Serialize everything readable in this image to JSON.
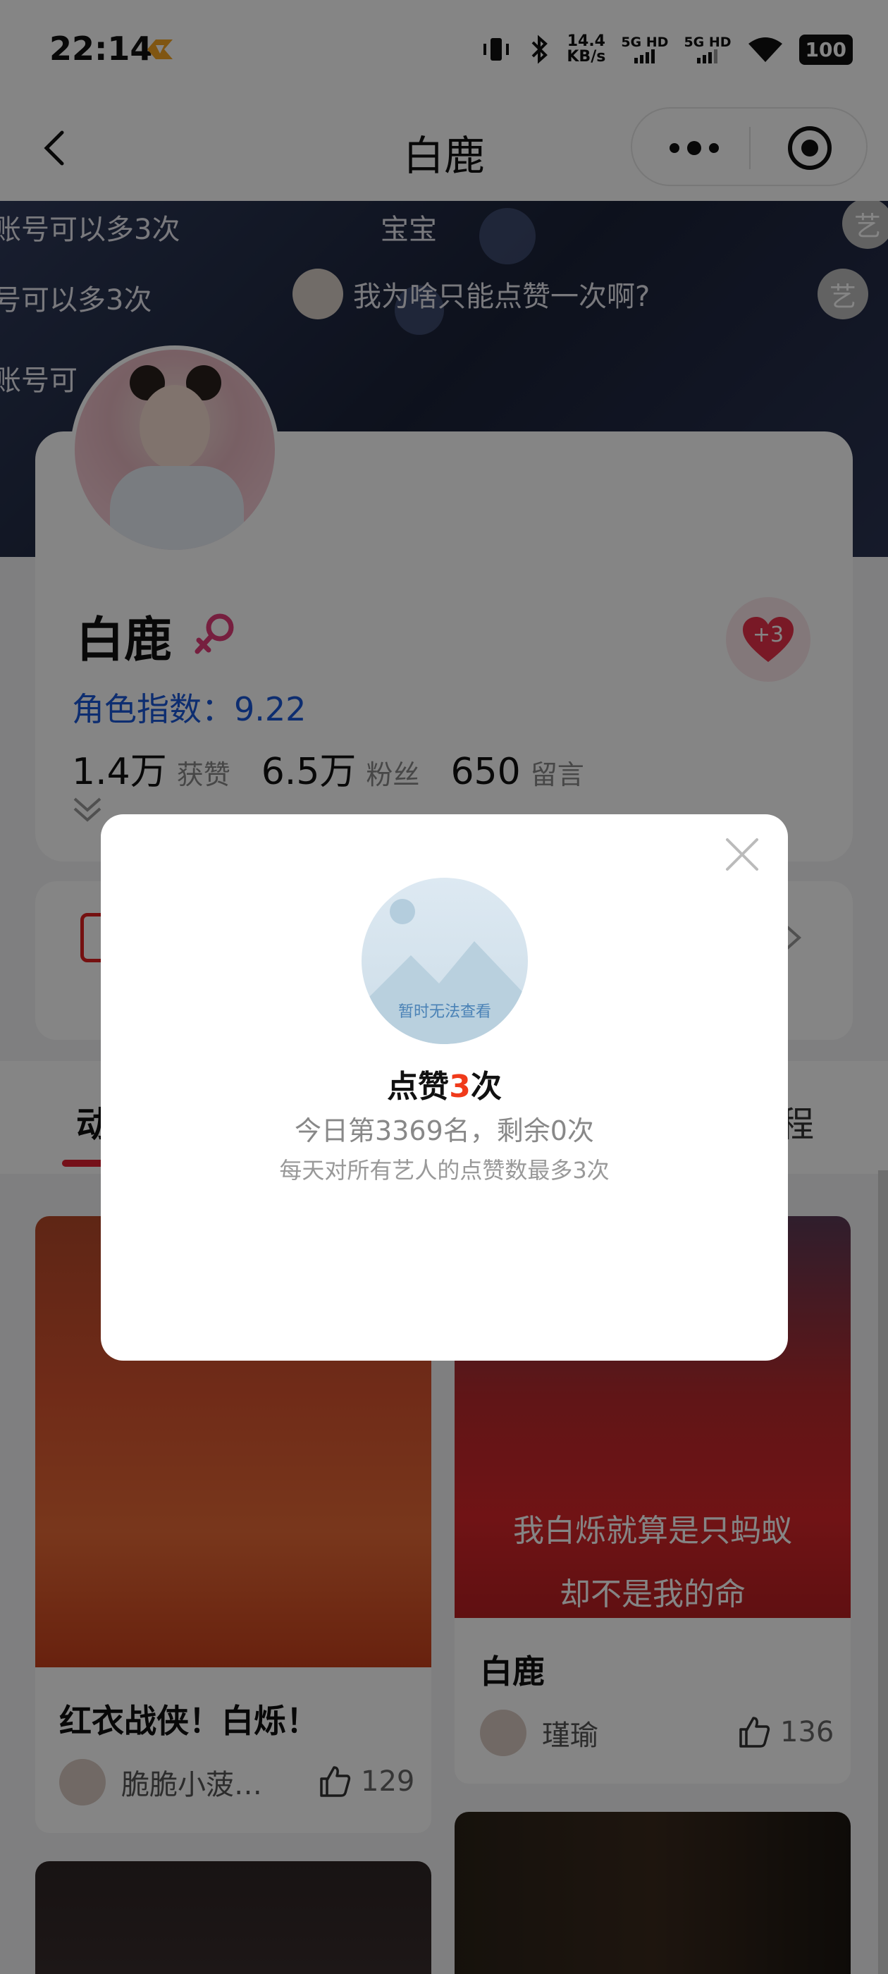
{
  "status_bar": {
    "time": "22:14",
    "speed_value": "14.4",
    "speed_unit": "KB/s",
    "sim1": "5G HD",
    "sim2": "5G HD",
    "battery": "100"
  },
  "navbar": {
    "title": "白鹿"
  },
  "danmaku": [
    {
      "text": "账号可以多3次"
    },
    {
      "text": "宝宝"
    },
    {
      "text": "号可以多3次"
    },
    {
      "text": "我为啥只能点赞一次啊?"
    },
    {
      "text": "账号可"
    }
  ],
  "danmaku_avatar_glyph": "艺",
  "profile": {
    "name": "白鹿",
    "index_label": "角色指数：",
    "index_value": "9.22",
    "likes_value": "1.4万",
    "likes_label": "获赞",
    "fans_value": "6.5万",
    "fans_label": "粉丝",
    "comments_value": "650",
    "comments_label": "留言",
    "heart_badge": "+3"
  },
  "tabs": {
    "first_visible": "动",
    "last_visible": "程"
  },
  "posts": [
    {
      "title": "红衣战侠！白烁！",
      "user": "脆脆小菠…",
      "likes": "129"
    },
    {
      "title": "白鹿",
      "user": "瑾瑜",
      "likes": "136",
      "subtitle_1": "我白烁就算是只蚂蚁",
      "subtitle_2": "却不是我的命"
    }
  ],
  "modal": {
    "image_hint": "暂时无法查看",
    "title_prefix": "点赞",
    "title_count": "3",
    "title_suffix": "次",
    "rank_text": "今日第3369名，剩余0次",
    "note_text": "每天对所有艺人的点赞数最多3次"
  },
  "colors": {
    "accent_red": "#e02030",
    "index_blue": "#1a56d6",
    "modal_count": "#f03a1a"
  }
}
